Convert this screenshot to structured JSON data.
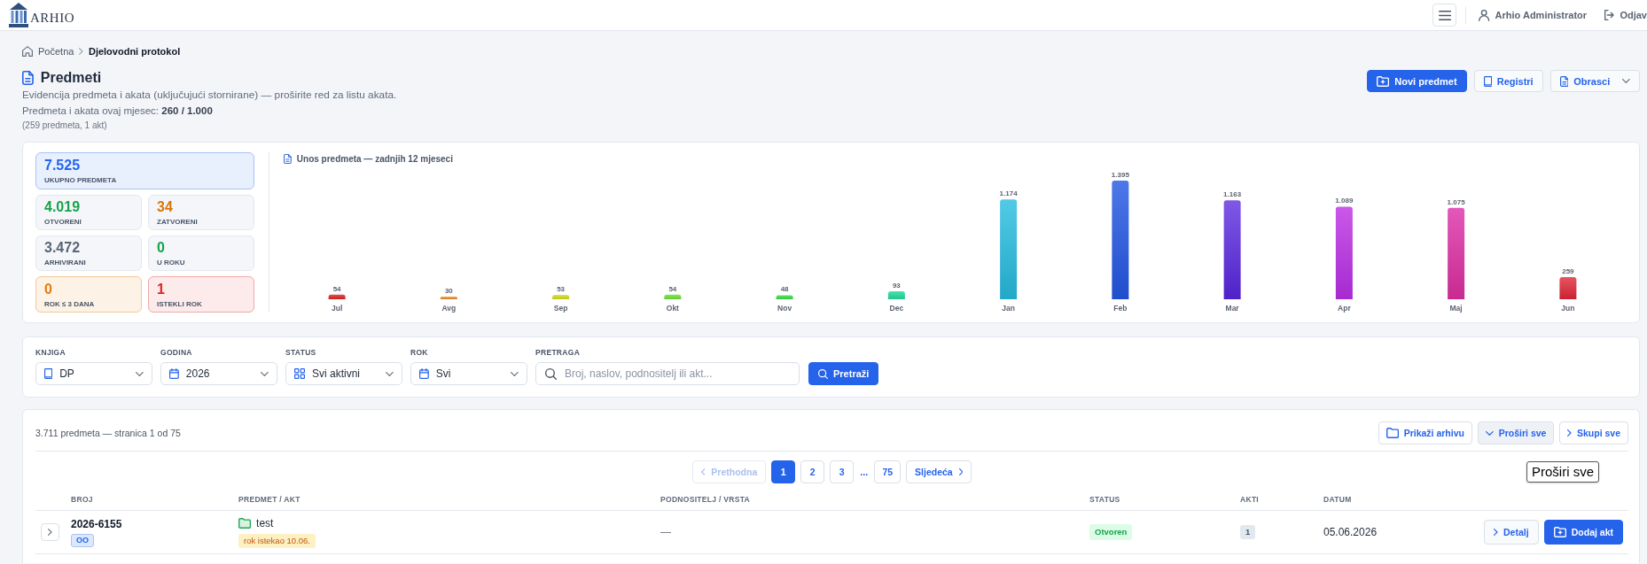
{
  "top_bar": {
    "logo": "ARHIO",
    "user": "Arhio Administrator",
    "logout": "Odjav"
  },
  "breadcrumb": [
    {
      "label": "Početna",
      "current": false
    },
    {
      "label": "Djelovodni protokol",
      "current": true
    }
  ],
  "header": {
    "title": "Predmeti",
    "subtitle": "Evidencija predmeta i akata (uključujući stornirane) — proširite red za listu akata.",
    "quota": "Predmeta i akata ovaj mjesec: **260 / 1.000**",
    "quota_note": "(259 predmeta, 1 akt)",
    "buttons": [
      {
        "label": "Novi predmet",
        "kind": "primary"
      },
      {
        "label": "Registri",
        "kind": "secondary"
      },
      {
        "label": "Obrasci",
        "kind": "dropdown"
      }
    ]
  },
  "stats": [
    {
      "value": "7.525",
      "label": "UKUPNO PREDMETA",
      "kind": "total",
      "color": "#2563eb"
    },
    {
      "value": "4.019",
      "label": "OTVORENI",
      "kind": "plain",
      "color": "#16a34a"
    },
    {
      "value": "34",
      "label": "ZATVORENI",
      "kind": "plain",
      "color": "#d97706"
    },
    {
      "value": "3.472",
      "label": "ARHIVIRANI",
      "kind": "plain",
      "color": "#5b6475"
    },
    {
      "value": "0",
      "label": "U ROKU",
      "kind": "plain",
      "color": "#16a34a"
    },
    {
      "value": "0",
      "label": "ROK ≤ 3 DANA",
      "kind": "warning",
      "color": "#e07b10"
    },
    {
      "value": "1",
      "label": "ISTEKLI ROK",
      "kind": "danger",
      "color": "#dc2626"
    }
  ],
  "chart": {
    "chart_data": {
      "type": "bar",
      "title": "Unos predmeta — zadnjih 12 mjeseci",
      "categories": [
        "Jul",
        "Avg",
        "Sep",
        "Okt",
        "Nov",
        "Dec",
        "Jan",
        "Feb",
        "Mar",
        "Apr",
        "Maj",
        "Jun"
      ],
      "values": [
        54,
        30,
        53,
        54,
        48,
        93,
        1174,
        1395,
        1163,
        1089,
        1075,
        259
      ],
      "value_labels": [
        "54",
        "30",
        "53",
        "54",
        "48",
        "93",
        "1.174",
        "1.395",
        "1.163",
        "1.089",
        "1.075",
        "259"
      ]
    }
  },
  "filters": {
    "fields": [
      {
        "label": "KNJIGA",
        "kind": "select",
        "value": "DP"
      },
      {
        "label": "GODINA",
        "kind": "select",
        "value": "2026"
      },
      {
        "label": "STATUS",
        "kind": "select",
        "value": "Svi aktivni"
      },
      {
        "label": "ROK",
        "kind": "select",
        "value": "Svi"
      },
      {
        "label": "PRETRAGA",
        "kind": "search",
        "placeholder": "Broj, naslov, podnositelj ili akt..."
      }
    ],
    "submit": "Pretraži"
  },
  "results": {
    "summary": "3.711 predmeta — stranica 1 od 75",
    "actions": [
      {
        "label": "Prikaži arhivu",
        "hovered": false
      },
      {
        "label": "Proširi sve",
        "hovered": true
      },
      {
        "label": "Skupi sve",
        "hovered": false
      }
    ],
    "tooltip": "Proširi sve",
    "pagination": {
      "prev": {
        "label": "Prethodna",
        "disabled": true
      },
      "pages": [
        {
          "kind": "page",
          "label": "1",
          "selected": true
        },
        {
          "kind": "page",
          "label": "2",
          "selected": false
        },
        {
          "kind": "page",
          "label": "3",
          "selected": false
        },
        {
          "kind": "gap",
          "label": "...",
          "selected": false
        },
        {
          "kind": "page",
          "label": "75",
          "selected": false
        }
      ],
      "next": {
        "label": "Sljedeća",
        "disabled": false
      }
    },
    "table": {
      "columns": [
        "BROJ",
        "PREDMET / AKT",
        "PODNOSITELJ / VRSTA",
        "STATUS",
        "AKTI",
        "DATUM"
      ],
      "rows": [
        {
          "expanded": false,
          "number": "2026-6155",
          "book": "OO",
          "title": "test",
          "deadline": "rok istekao 10.06.",
          "applicant": "—",
          "status": "Otvoren",
          "acts": "1",
          "date": "05.06.2026",
          "actions": [
            {
              "label": "Detalj",
              "kind": "secondary"
            },
            {
              "label": "Dodaj akt",
              "kind": "primary"
            }
          ]
        }
      ]
    }
  }
}
